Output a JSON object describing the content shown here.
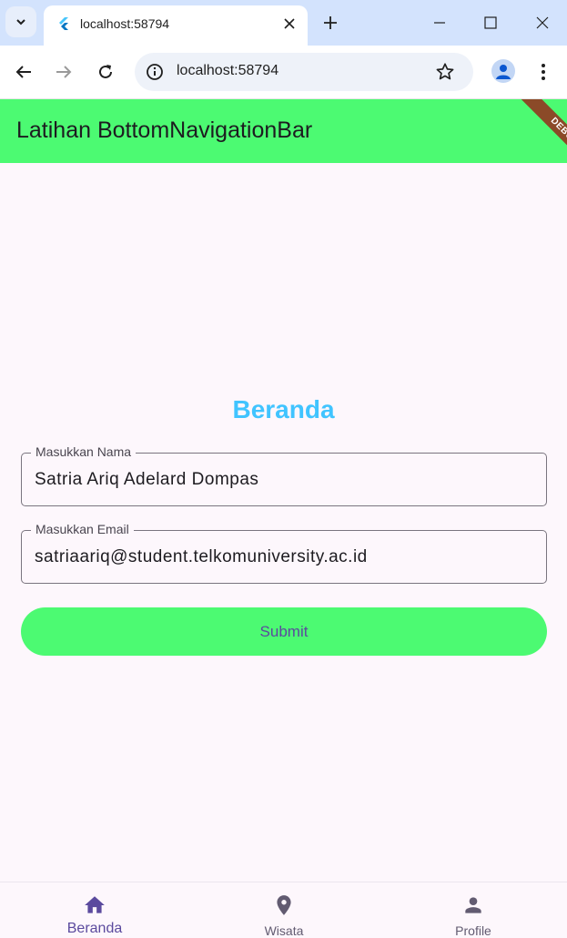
{
  "browser": {
    "tab_title": "localhost:58794",
    "url": "localhost:58794"
  },
  "app": {
    "title": "Latihan BottomNavigationBar",
    "debug_banner": "DEBUG",
    "heading": "Beranda",
    "form": {
      "name_label": "Masukkan Nama",
      "name_value": "Satria Ariq Adelard Dompas",
      "email_label": "Masukkan Email",
      "email_value": "satriaariq@student.telkomuniversity.ac.id",
      "submit_label": "Submit"
    },
    "bottom_nav": [
      {
        "label": "Beranda",
        "icon": "home-icon",
        "selected": true
      },
      {
        "label": "Wisata",
        "icon": "location-pin-icon",
        "selected": false
      },
      {
        "label": "Profile",
        "icon": "person-icon",
        "selected": false
      }
    ]
  },
  "colors": {
    "appbar": "#4cfa72",
    "heading": "#40c4ff",
    "selected_nav": "#5b4a9e",
    "unselected_nav": "#625b71",
    "background": "#fdf7fc"
  }
}
